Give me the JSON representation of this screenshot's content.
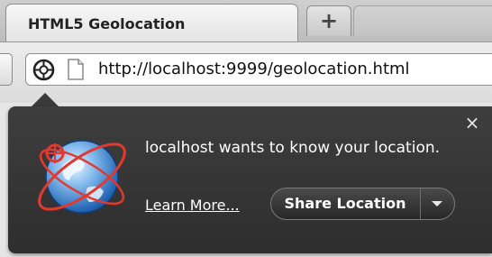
{
  "browser": {
    "tab_title": "HTML5 Geolocation",
    "new_tab_label": "+",
    "url": "http://localhost:9999/geolocation.html"
  },
  "icons": {
    "location": "location-crosshair-icon",
    "page": "page-icon",
    "globe": "globe-icon",
    "close": "close-icon",
    "dropdown": "chevron-down-icon"
  },
  "geolocation_prompt": {
    "message": "localhost wants to know your location.",
    "close_label": "×",
    "learn_more_label": "Learn More...",
    "share_button_label": "Share Location"
  },
  "colors": {
    "popup_background": "#353535",
    "popup_text": "#ffffff",
    "globe_blue": "#2a73c4",
    "orbit_red": "#e03a2f"
  }
}
